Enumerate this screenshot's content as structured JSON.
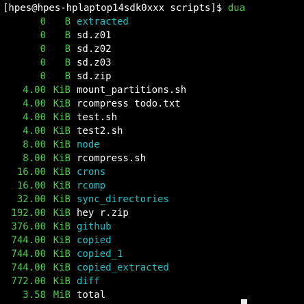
{
  "terminal": {
    "prompt": "[hpes@hpes-hplaptop14sdk0xxx scripts]$ ",
    "command": "dua",
    "entries": [
      {
        "size": "0",
        "unit": "B",
        "name": "extracted",
        "type": "dir"
      },
      {
        "size": "0",
        "unit": "B",
        "name": "sd.z01",
        "type": "file"
      },
      {
        "size": "0",
        "unit": "B",
        "name": "sd.z02",
        "type": "file"
      },
      {
        "size": "0",
        "unit": "B",
        "name": "sd.z03",
        "type": "file"
      },
      {
        "size": "0",
        "unit": "B",
        "name": "sd.zip",
        "type": "file"
      },
      {
        "size": "4.00",
        "unit": "KiB",
        "name": "mount_partitions.sh",
        "type": "file"
      },
      {
        "size": "4.00",
        "unit": "KiB",
        "name": "rcompress todo.txt",
        "type": "file"
      },
      {
        "size": "4.00",
        "unit": "KiB",
        "name": "test.sh",
        "type": "file"
      },
      {
        "size": "4.00",
        "unit": "KiB",
        "name": "test2.sh",
        "type": "file"
      },
      {
        "size": "8.00",
        "unit": "KiB",
        "name": "node",
        "type": "dir"
      },
      {
        "size": "8.00",
        "unit": "KiB",
        "name": "rcompress.sh",
        "type": "file"
      },
      {
        "size": "16.00",
        "unit": "KiB",
        "name": "crons",
        "type": "dir"
      },
      {
        "size": "16.00",
        "unit": "KiB",
        "name": "rcomp",
        "type": "dir"
      },
      {
        "size": "32.00",
        "unit": "KiB",
        "name": "sync_directories",
        "type": "dir"
      },
      {
        "size": "192.00",
        "unit": "KiB",
        "name": "hey r.zip",
        "type": "file"
      },
      {
        "size": "376.00",
        "unit": "KiB",
        "name": "github",
        "type": "dir"
      },
      {
        "size": "744.00",
        "unit": "KiB",
        "name": "copied",
        "type": "dir"
      },
      {
        "size": "744.00",
        "unit": "KiB",
        "name": "copied_1",
        "type": "dir"
      },
      {
        "size": "744.00",
        "unit": "KiB",
        "name": "copied_extracted",
        "type": "dir"
      },
      {
        "size": "772.00",
        "unit": "KiB",
        "name": "diff",
        "type": "dir"
      },
      {
        "size": "3.58",
        "unit": "MiB",
        "name": "total",
        "type": "file"
      }
    ]
  },
  "colors": {
    "background": "#000000",
    "size_green": "#4ec94e",
    "dir_cyan": "#22bfc4",
    "file_white": "#ffffff"
  }
}
